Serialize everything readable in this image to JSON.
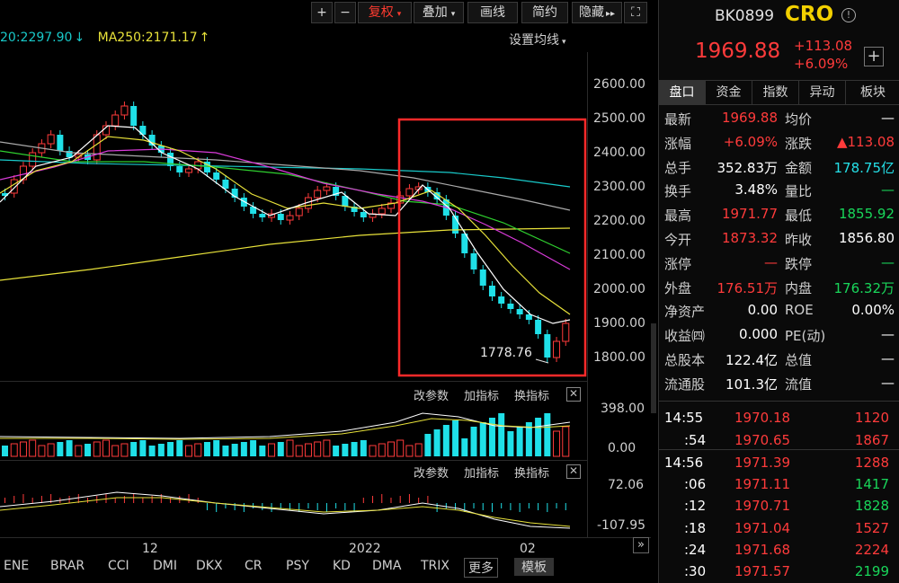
{
  "toolbar": {
    "plus": "+",
    "minus": "−",
    "fuquan": "复权",
    "diejia": "叠加",
    "huaxian": "画线",
    "jianyue": "简约",
    "yincang": "隐藏",
    "more_arrow": "▸▸",
    "fullscreen": "⛶"
  },
  "ma_legend": {
    "ma_partial": "20:2297.90",
    "ma_partial_arrow": "↓",
    "ma250": "MA250:2171.17",
    "ma250_arrow": "↑",
    "settings": "设置均线"
  },
  "y_axis_labels": [
    "2600.00",
    "2500.00",
    "2400.00",
    "2300.00",
    "2200.00",
    "2100.00",
    "2000.00",
    "1900.00",
    "1800.00"
  ],
  "annotation_low": "1778.76",
  "volume_panel": {
    "btn_params": "改参数",
    "btn_add": "加指标",
    "btn_swap": "换指标",
    "close": "✕",
    "ymax": "398.00",
    "ymin": "0.00"
  },
  "macd_panel": {
    "btn_params": "改参数",
    "btn_add": "加指标",
    "btn_swap": "换指标",
    "close": "✕",
    "ymax": "72.06",
    "ymin": "-107.95"
  },
  "x_axis_labels": [
    "12",
    "2022",
    "02"
  ],
  "bottom_tabs": [
    "ENE",
    "BRAR",
    "CCI",
    "DMI",
    "DKX",
    "CR",
    "PSY",
    "KD",
    "DMA",
    "TRIX"
  ],
  "bottom_more": "更多",
  "bottom_template": "模板",
  "bottom_scroll": "»",
  "stock": {
    "code": "BK0899",
    "name": "CRO",
    "info_icon": "info-icon",
    "price": "1969.88",
    "change": "+113.08",
    "change_pct": "+6.09%",
    "add": "+"
  },
  "right_tabs": [
    "盘口",
    "资金",
    "指数",
    "异动",
    "板块"
  ],
  "quote": [
    {
      "l1": "最新",
      "v1": "1969.88",
      "c1": "red",
      "l2": "均价",
      "v2": "—",
      "c2": "white"
    },
    {
      "l1": "涨幅",
      "v1": "+6.09%",
      "c1": "red",
      "l2": "涨跌",
      "v2": "▲113.08",
      "c2": "red"
    },
    {
      "l1": "总手",
      "v1": "352.83万",
      "c1": "white",
      "l2": "金额",
      "v2": "178.75亿",
      "c2": "cyan"
    },
    {
      "l1": "换手",
      "v1": "3.48%",
      "c1": "white",
      "l2": "量比",
      "v2": "—",
      "c2": "green"
    },
    {
      "l1": "最高",
      "v1": "1971.77",
      "c1": "red",
      "l2": "最低",
      "v2": "1855.92",
      "c2": "green"
    },
    {
      "l1": "今开",
      "v1": "1873.32",
      "c1": "red",
      "l2": "昨收",
      "v2": "1856.80",
      "c2": "white"
    },
    {
      "l1": "涨停",
      "v1": "—",
      "c1": "red",
      "l2": "跌停",
      "v2": "—",
      "c2": "green"
    },
    {
      "l1": "外盘",
      "v1": "176.51万",
      "c1": "red",
      "l2": "内盘",
      "v2": "176.32万",
      "c2": "green"
    },
    {
      "l1": "净资产",
      "v1": "0.00",
      "c1": "white",
      "l2": "ROE",
      "v2": "0.00%",
      "c2": "white"
    },
    {
      "l1": "收益㈣",
      "v1": "0.000",
      "c1": "white",
      "l2": "PE(动)",
      "v2": "—",
      "c2": "white"
    },
    {
      "l1": "总股本",
      "v1": "122.4亿",
      "c1": "white",
      "l2": "总值",
      "v2": "—",
      "c2": "white"
    },
    {
      "l1": "流通股",
      "v1": "101.3亿",
      "c1": "white",
      "l2": "流值",
      "v2": "—",
      "c2": "white"
    }
  ],
  "ticks": [
    {
      "t": "14:55",
      "p": "1970.18",
      "v": "1120",
      "vc": "red"
    },
    {
      "t": ":54",
      "p": "1970.65",
      "v": "1867",
      "vc": "red"
    },
    {
      "t": "14:56",
      "p": "1971.39",
      "v": "1288",
      "vc": "red"
    },
    {
      "t": ":06",
      "p": "1971.11",
      "v": "1417",
      "vc": "green"
    },
    {
      "t": ":12",
      "p": "1970.71",
      "v": "1828",
      "vc": "green"
    },
    {
      "t": ":18",
      "p": "1971.04",
      "v": "1527",
      "vc": "red"
    },
    {
      "t": ":24",
      "p": "1971.68",
      "v": "2224",
      "vc": "red"
    },
    {
      "t": ":30",
      "p": "1971.57",
      "v": "2199",
      "vc": "green"
    }
  ],
  "colors": {
    "up": "#ff3b3b",
    "down": "#1fe0e8",
    "highlight_box": "#ff2a2a",
    "ma5": "#ffffff",
    "ma10": "#e8e23a",
    "ma20": "#d93bd9",
    "ma30": "#2fd02f",
    "ma60": "#aaaaaa",
    "ma120": "#19c9c9",
    "ma250": "#e8e23a"
  }
}
